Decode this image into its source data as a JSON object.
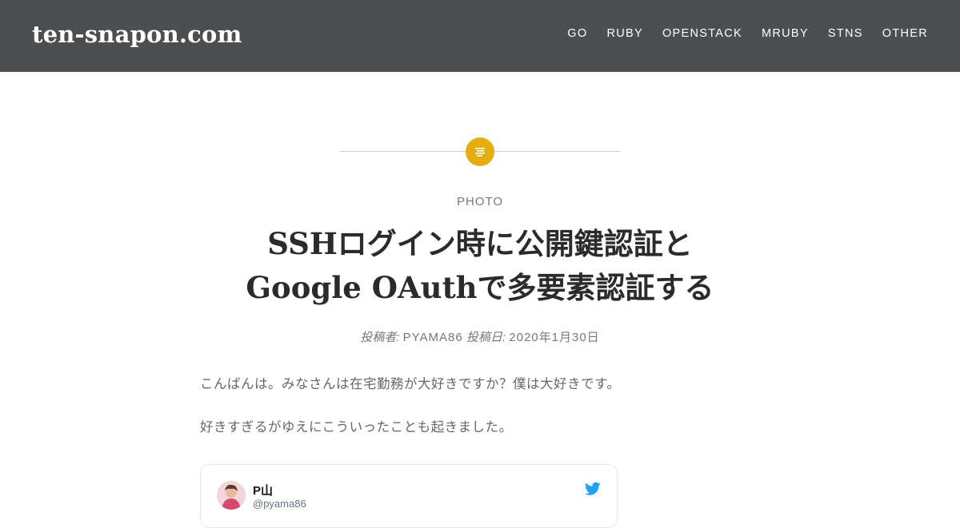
{
  "site": {
    "title": "ten-snapon.com"
  },
  "nav": {
    "items": [
      {
        "label": "GO"
      },
      {
        "label": "RUBY"
      },
      {
        "label": "OPENSTACK"
      },
      {
        "label": "MRUBY"
      },
      {
        "label": "STNS"
      },
      {
        "label": "OTHER"
      }
    ]
  },
  "post": {
    "format_icon": "document-lines-icon",
    "category": "PHOTO",
    "title_line1": "SSHログイン時に公開鍵認証と",
    "title_line2": "Google OAuthで多要素認証する",
    "meta": {
      "author_label": "投稿者:",
      "author": "PYAMA86",
      "date_label": "投稿日:",
      "date": "2020年1月30日"
    },
    "paragraphs": [
      "こんばんは。みなさんは在宅勤務が大好きですか？僕は大好きです。",
      "好きすぎるがゆえにこういったことも起きました。"
    ]
  },
  "tweet": {
    "name": "P山",
    "handle": "@pyama86",
    "icon": "twitter-bird-icon"
  },
  "colors": {
    "header_bg": "#4d4e50",
    "accent": "#e5ae10",
    "twitter_blue": "#1da1f2"
  }
}
